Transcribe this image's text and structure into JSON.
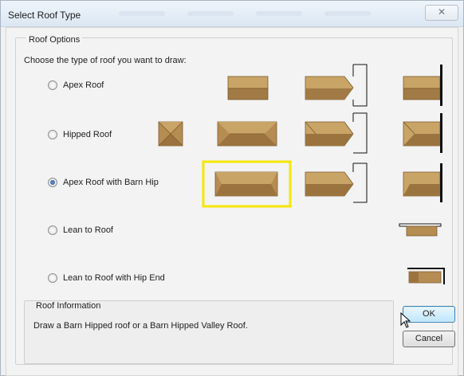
{
  "window": {
    "title": "Select Roof Type",
    "close_glyph": "✕"
  },
  "roof_options": {
    "group_label": "Roof Options",
    "instruction": "Choose the type of roof you want to draw:",
    "options": [
      {
        "label": "Apex Roof",
        "selected": false
      },
      {
        "label": "Hipped Roof",
        "selected": false
      },
      {
        "label": "Apex Roof with Barn Hip",
        "selected": true
      },
      {
        "label": "Lean to Roof",
        "selected": false
      },
      {
        "label": "Lean to Roof with Hip End",
        "selected": false
      }
    ],
    "selected_style_highlight": "#f5e600"
  },
  "roof_information": {
    "group_label": "Roof Information",
    "text": "Draw a Barn Hipped roof or a Barn Hipped Valley Roof."
  },
  "buttons": {
    "ok": "OK",
    "cancel": "Cancel"
  },
  "colors": {
    "roof_fill": "#c7a164",
    "roof_dark": "#9b733e",
    "roof_light": "#dcc08c",
    "highlight": "#f5e600"
  }
}
